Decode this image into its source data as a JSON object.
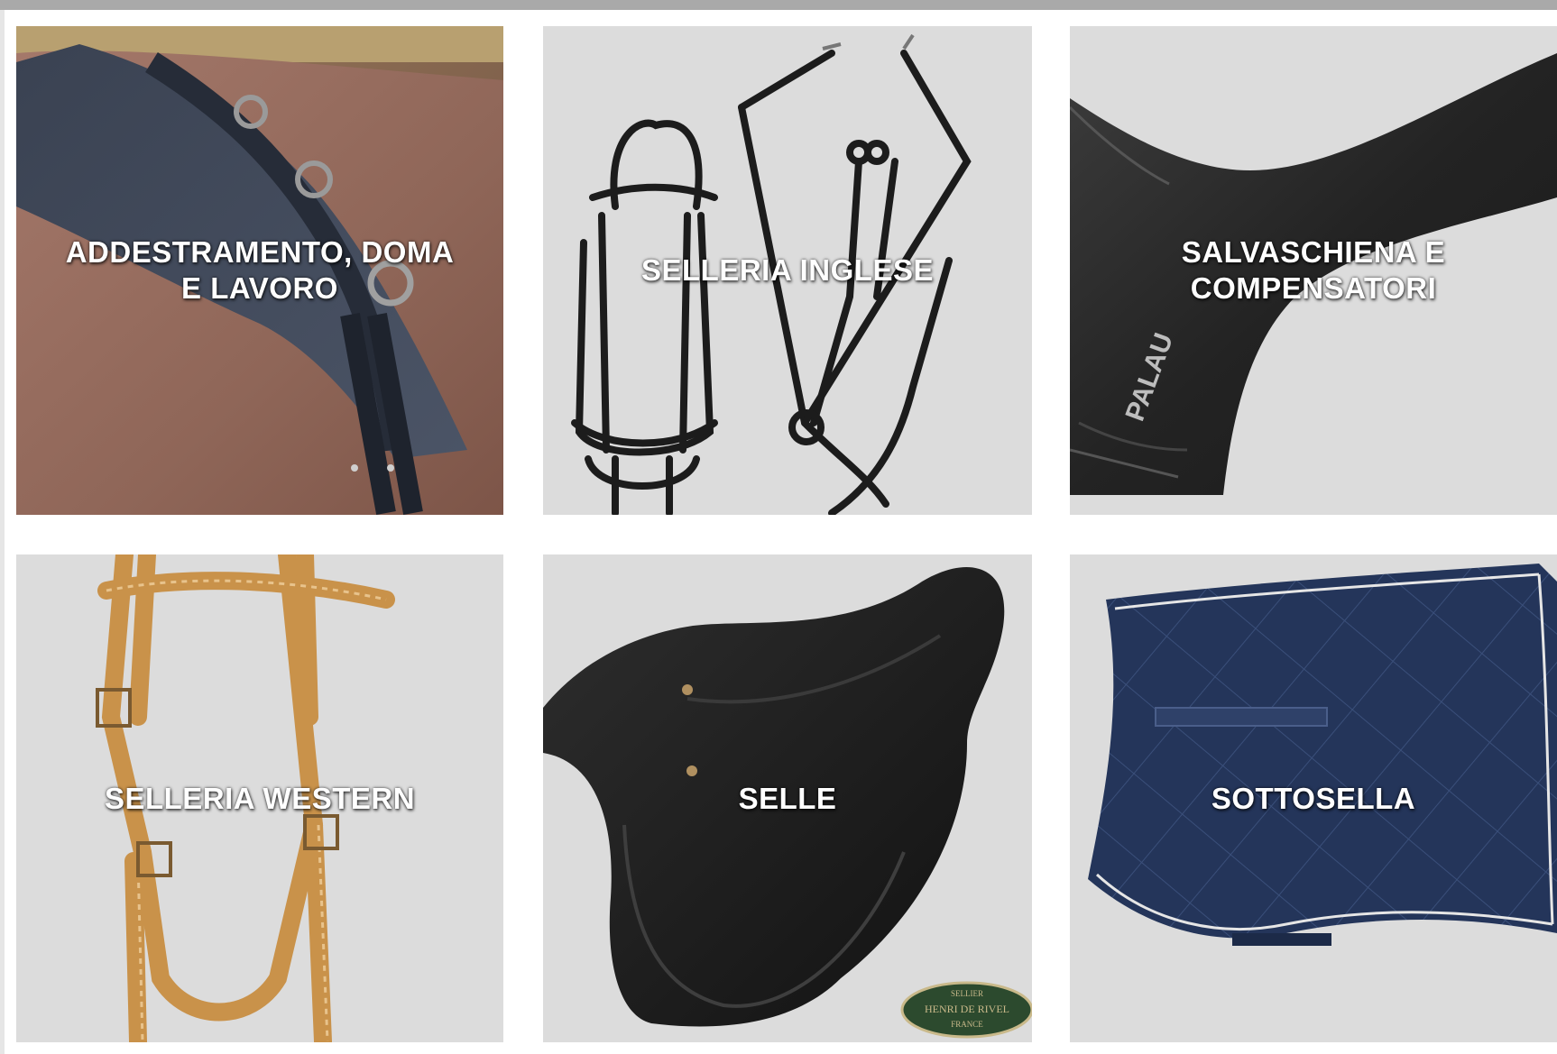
{
  "categories": [
    {
      "label": "ADDESTRAMENTO, DOMA E LAVORO",
      "image": "training-pad-on-horse"
    },
    {
      "label": "SELLERIA INGLESE",
      "image": "english-bridle-and-breastplate"
    },
    {
      "label": "SALVASCHIENA E COMPENSATORI",
      "image": "black-saddle-pad-palau"
    },
    {
      "label": "SELLERIA WESTERN",
      "image": "western-leather-headstall"
    },
    {
      "label": "SELLE",
      "image": "black-jumping-saddle"
    },
    {
      "label": "SOTTOSELLA",
      "image": "navy-quilted-saddle-pad"
    }
  ],
  "badges": {
    "palau_logo": "PALAU",
    "henri_de_rivel": [
      "SELLIER",
      "HENRI DE RIVEL",
      "FRANCE"
    ]
  },
  "colors": {
    "top_bar": "#a9a9a9",
    "tile_background": "#dcdcdc",
    "label_text": "#ffffff"
  }
}
